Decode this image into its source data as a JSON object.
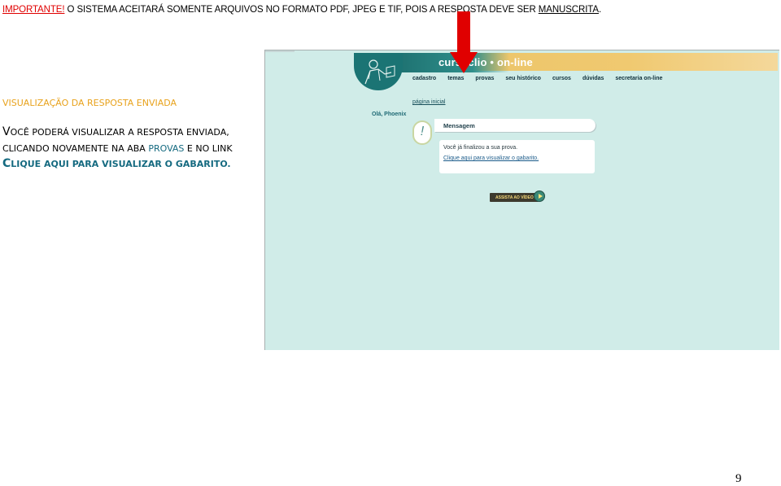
{
  "notice": {
    "important": "IMPORTANTE!",
    "text": " O SISTEMA ACEITARÁ SOMENTE ARQUIVOS NO FORMATO PDF, JPEG E TIF, POIS A RESPOSTA DEVE SER ",
    "underlined": "MANUSCRITA",
    "end": "."
  },
  "instructions": {
    "title": "VISUALIZAÇÃO DA RESPOSTA ENVIADA",
    "line1_initial": "V",
    "line1_rest": "OCÊ PODERÁ VISUALIZAR A RESPOSTA ENVIADA,",
    "line2_start": "CLICANDO NOVAMENTE NA ABA ",
    "line2_link": "PROVAS",
    "line2_end": " E NO LINK",
    "line3_initial": "C",
    "line3_rest": "LIQUE AQUI PARA VISUALIZAR O GABARITO."
  },
  "site": {
    "brand": "cursoclio • on-line",
    "nav": [
      "cadastro",
      "temas",
      "provas",
      "seu histórico",
      "cursos",
      "dúvidas",
      "secretaria on-line"
    ],
    "home_link": "página inicial",
    "greeting": "Olá, Phoenix",
    "message_title": "Mensagem",
    "message_text": "Você já finalizou a sua prova.",
    "message_link": "Clique aqui para visualizar o gabarito.",
    "video_button": "ASSISTA AO VÍDEO",
    "bang": "!"
  },
  "page_number": "9",
  "colors": {
    "arrow": "#e00000",
    "background": "#d0ece8",
    "accent": "#e8a21c"
  }
}
